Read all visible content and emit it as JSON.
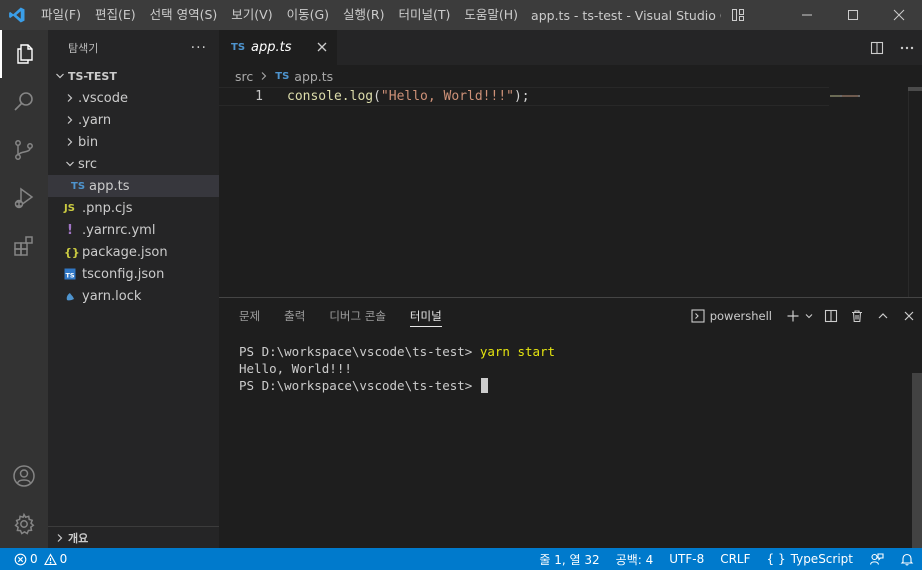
{
  "titlebar": {
    "menu": [
      "파일(F)",
      "편집(E)",
      "선택 영역(S)",
      "보기(V)",
      "이동(G)",
      "실행(R)",
      "터미널(T)",
      "도움말(H)"
    ],
    "title": "app.ts - ts-test - Visual Studio C..."
  },
  "sidebar": {
    "title": "탐색기",
    "more": "···",
    "root": "TS-TEST",
    "items": [
      {
        "label": ".vscode",
        "icon": "chevron-right-icon"
      },
      {
        "label": ".yarn",
        "icon": "chevron-right-icon"
      },
      {
        "label": "bin",
        "icon": "chevron-right-icon"
      },
      {
        "label": "src",
        "icon": "chevron-down-icon"
      },
      {
        "label": "app.ts",
        "badge": "TS"
      },
      {
        "label": ".pnp.cjs",
        "badge": "JS"
      },
      {
        "label": ".yarnrc.yml",
        "badge": "!"
      },
      {
        "label": "package.json",
        "badge": "{}"
      },
      {
        "label": "tsconfig.json",
        "badge": "TS"
      },
      {
        "label": "yarn.lock",
        "icon": "yarn-icon"
      }
    ],
    "outline_label": "개요"
  },
  "editor": {
    "tab": {
      "badge": "TS",
      "label": "app.ts"
    },
    "breadcrumb": {
      "folder": "src",
      "badge": "TS",
      "file": "app.ts"
    },
    "line_number": "1",
    "code": {
      "fn": "console.log",
      "open": "(",
      "str": "\"Hello, World!!!\"",
      "close": ");"
    }
  },
  "panel": {
    "tabs": [
      "문제",
      "출력",
      "디버그 콘솔",
      "터미널"
    ],
    "active_tab": "터미널",
    "shell": "powershell",
    "terminal": {
      "line1_prompt": "PS D:\\workspace\\vscode\\ts-test> ",
      "line1_cmd": "yarn start",
      "line2": "Hello, World!!!",
      "line3_prompt": "PS D:\\workspace\\vscode\\ts-test> "
    }
  },
  "statusbar": {
    "errors": "0",
    "warnings": "0",
    "position": "줄 1, 열 32",
    "indent": "공백: 4",
    "encoding": "UTF-8",
    "eol": "CRLF",
    "language_bracket": "{ }",
    "language": "TypeScript"
  },
  "colors": {
    "accent": "#007acc",
    "ts_badge": "#4e94ce",
    "js_badge": "#cbcb41",
    "json_badge": "#cbcb41",
    "yml_badge": "#a074c4"
  }
}
